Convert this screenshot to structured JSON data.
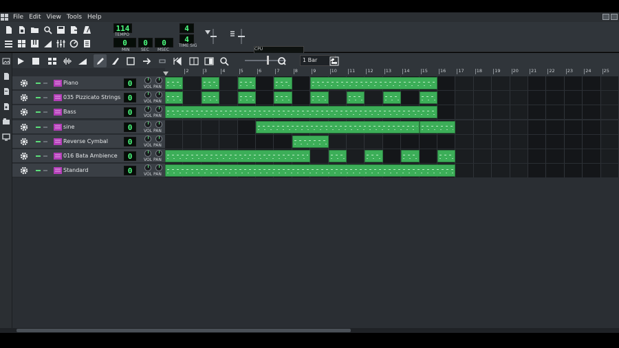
{
  "menu": [
    "File",
    "Edit",
    "View",
    "Tools",
    "Help"
  ],
  "transport": {
    "tempo": "114",
    "tempo_label": "TEMPO",
    "min": "0",
    "sec": "0",
    "msec": "0",
    "min_label": "MIN",
    "sec_label": "SEC",
    "msec_label": "MSEC",
    "timesig_num": "4",
    "timesig_den": "4",
    "timesig_label": "TIME SIG",
    "cpu_label": "CPU"
  },
  "zoom": {
    "snap_value": "1 Bar"
  },
  "ruler": [
    "2",
    "3",
    "4",
    "5",
    "6",
    "7",
    "8",
    "9",
    "10",
    "11",
    "12",
    "13",
    "14",
    "15",
    "16",
    "17",
    "18",
    "19",
    "20",
    "21",
    "22",
    "23",
    "24",
    "25"
  ],
  "tracks": [
    {
      "name": "Piano",
      "value": "0",
      "vol_label": "VOL",
      "pan_label": "PAN",
      "clips": [
        [
          1,
          2
        ],
        [
          3,
          4
        ],
        [
          5,
          6
        ],
        [
          7,
          8
        ],
        [
          9,
          16
        ]
      ]
    },
    {
      "name": "035 Pizzicato Strings",
      "value": "0",
      "vol_label": "VOL",
      "pan_label": "PAN",
      "clips": [
        [
          1,
          2
        ],
        [
          3,
          4
        ],
        [
          5,
          6
        ],
        [
          7,
          8
        ],
        [
          9,
          10
        ],
        [
          11,
          12
        ],
        [
          13,
          14
        ],
        [
          15,
          16
        ]
      ]
    },
    {
      "name": "Bass",
      "value": "0",
      "vol_label": "VOL",
      "pan_label": "PAN",
      "clips": [
        [
          1,
          16
        ]
      ]
    },
    {
      "name": "sine",
      "value": "0",
      "vol_label": "VOL",
      "pan_label": "PAN",
      "clips": [
        [
          6,
          15
        ],
        [
          15,
          17
        ]
      ]
    },
    {
      "name": "Reverse Cymbal",
      "value": "0",
      "vol_label": "VOL",
      "pan_label": "PAN",
      "clips": [
        [
          8,
          10
        ]
      ]
    },
    {
      "name": "016 Bata Ambience",
      "value": "0",
      "vol_label": "VOL",
      "pan_label": "PAN",
      "clips": [
        [
          1,
          9
        ],
        [
          10,
          11
        ],
        [
          12,
          13
        ],
        [
          14,
          15
        ],
        [
          16,
          17
        ]
      ]
    },
    {
      "name": "Standard",
      "value": "0",
      "vol_label": "VOL",
      "pan_label": "PAN",
      "clips": [
        [
          1,
          17
        ]
      ]
    }
  ],
  "colors": {
    "clip": "#3cae58",
    "lcd_text": "#4dff80",
    "panel": "#3a3f45"
  }
}
